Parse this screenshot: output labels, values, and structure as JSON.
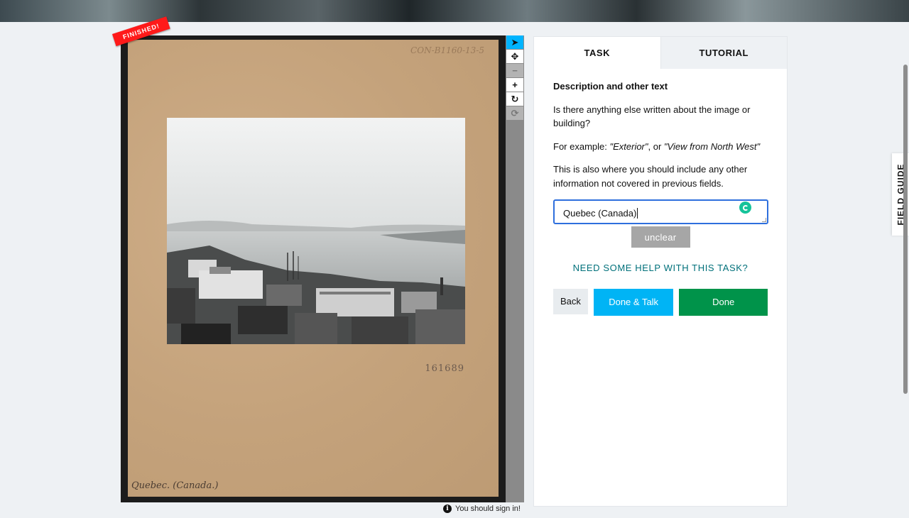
{
  "viewer": {
    "ribbon": "FINISHED!",
    "card_id": "CON-B1160-13-5",
    "card_number": "161689",
    "card_caption": "Quebec. (Canada.)",
    "sign_in_notice": "You should sign in!"
  },
  "toolbar": {
    "tools": [
      {
        "name": "pointer-tool",
        "icon": "cursor-arrow-icon",
        "glyph": "➤",
        "state": "active"
      },
      {
        "name": "pan-tool",
        "icon": "move-arrows-icon",
        "glyph": "✥",
        "state": "normal"
      },
      {
        "name": "zoom-out-tool",
        "icon": "minus-icon",
        "glyph": "−",
        "state": "disabled"
      },
      {
        "name": "zoom-in-tool",
        "icon": "plus-icon",
        "glyph": "+",
        "state": "normal"
      },
      {
        "name": "rotate-tool",
        "icon": "rotate-icon",
        "glyph": "↻",
        "state": "normal"
      },
      {
        "name": "reset-tool",
        "icon": "refresh-icon",
        "glyph": "⟳",
        "state": "disabled"
      }
    ]
  },
  "tabs": {
    "task": "TASK",
    "tutorial": "TUTORIAL"
  },
  "task": {
    "heading": "Description and other text",
    "question": "Is there anything else written about the image or building?",
    "example_prefix": "For example: ",
    "example_1": "\"Exterior\"",
    "example_sep": ", or ",
    "example_2": "\"View from North West\"",
    "extra": "This is also where you should include any other information not covered in previous fields.",
    "input_value": "Quebec (Canada)",
    "unclear_label": "unclear",
    "help_link": "NEED SOME HELP WITH THIS TASK?",
    "back_label": "Back",
    "done_talk_label": "Done & Talk",
    "done_label": "Done"
  },
  "field_guide": {
    "label": "FIELD GUIDE"
  },
  "colors": {
    "accent_blue": "#00b4f5",
    "done_green": "#00934a",
    "help_teal": "#00707a",
    "ribbon_red": "#ff1a1a",
    "input_border": "#2e6fdd"
  }
}
